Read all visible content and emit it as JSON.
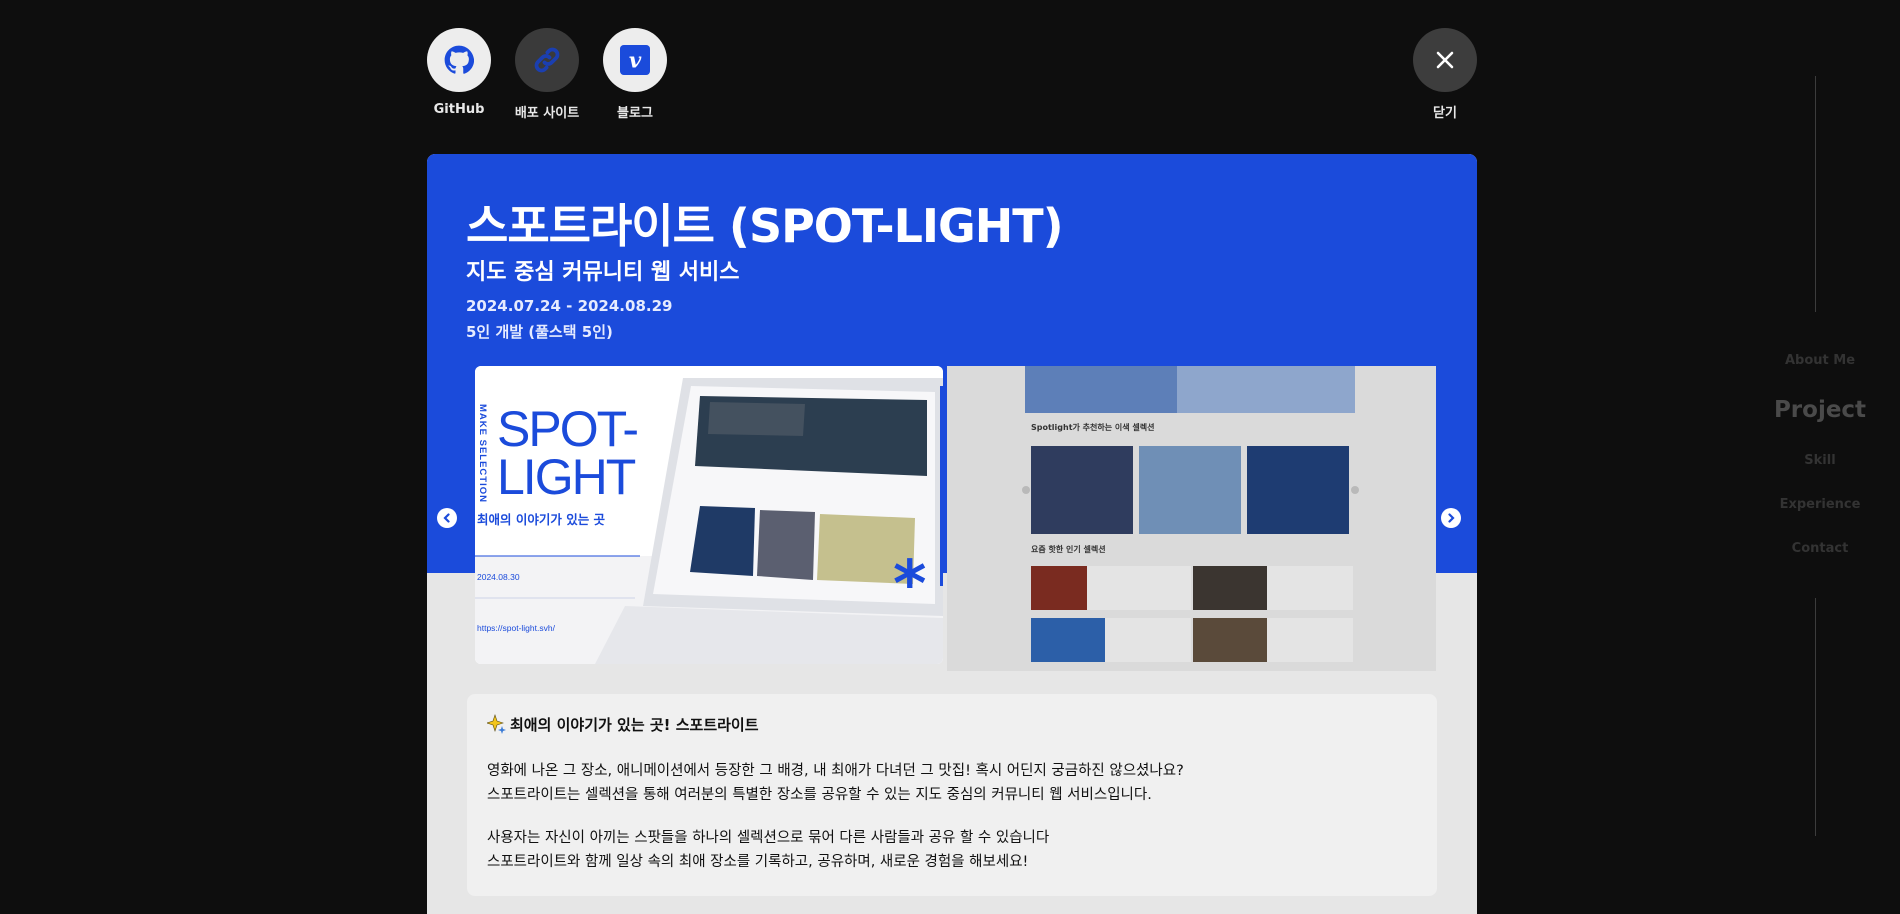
{
  "links": {
    "github_label": "GitHub",
    "deploy_label": "배포 사이트",
    "blog_label": "블로그",
    "close_label": "닫기"
  },
  "project": {
    "title": "스포트라이트 (SPOT-LIGHT)",
    "subtitle": "지도 중심 커뮤니티 웹 서비스",
    "period": "2024.07.24 - 2024.08.29",
    "team": "5인 개발 (풀스택 5인)"
  },
  "slides": {
    "slide1": {
      "vertical_text": "MAKE SELECTION",
      "logo_line1": "SPOT-",
      "logo_line2": "LIGHT",
      "tagline": "최애의 이야기가 있는 곳",
      "date": "2024.08.30",
      "url": "https://spot-light.svh/"
    },
    "slide2": {
      "section_title": "Spotlight가 추천하는 이색 셀렉션",
      "popular_title": "요즘 핫한 인기 셀렉션"
    }
  },
  "description": {
    "heading": "최애의 이야기가 있는 곳! 스포트라이트",
    "para1_line1": "영화에 나온 그 장소, 애니메이션에서 등장한 그 배경, 내 최애가 다녀던 그 맛집! 혹시 어딘지 궁금하진 않으셨나요?",
    "para1_line2": "스포트라이트는 셀렉션을 통해 여러분의 특별한 장소를 공유할 수 있는 지도 중심의 커뮤니티 웹 서비스입니다.",
    "para2_line1": "사용자는 자신이 아끼는 스팟들을 하나의 셀렉션으로 묶어 다른 사람들과 공유 할 수 있습니다",
    "para2_line2": "스포트라이트와 함께 일상 속의 최애 장소를 기록하고, 공유하며, 새로운 경험을 해보세요!"
  },
  "sidenav": {
    "items": [
      {
        "label": "About Me"
      },
      {
        "label": "Project"
      },
      {
        "label": "Skill"
      },
      {
        "label": "Experience"
      },
      {
        "label": "Contact"
      }
    ],
    "active": "Project"
  },
  "colors": {
    "brand_blue": "#1b4bdb",
    "background": "#0e0e0e"
  },
  "icons": [
    "github-icon",
    "link-icon",
    "velog-icon",
    "close-icon",
    "chevron-left-icon",
    "chevron-right-icon",
    "sparkle-icon"
  ]
}
